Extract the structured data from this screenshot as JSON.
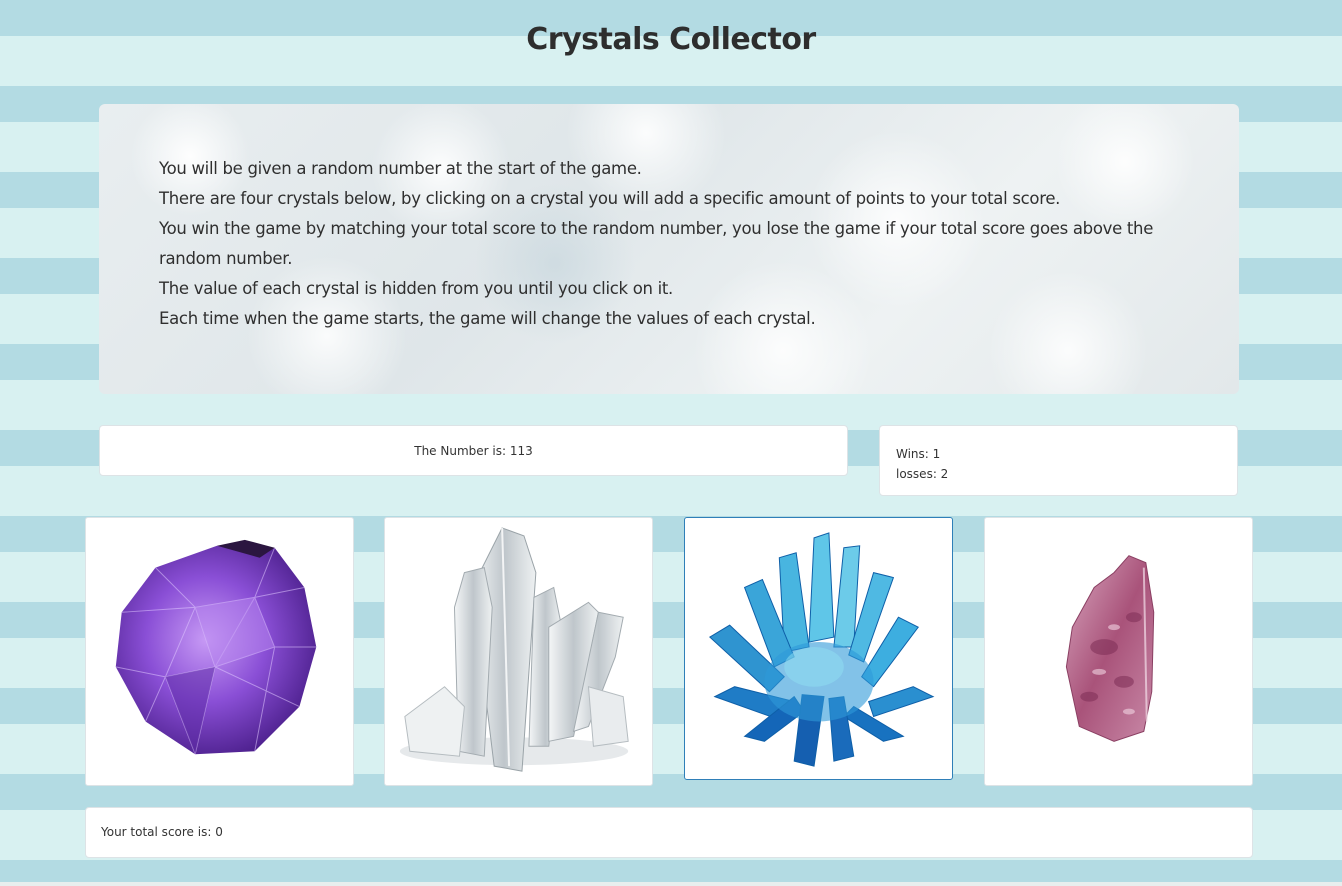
{
  "header": {
    "title": "Crystals Collector"
  },
  "instructions": [
    "You will be given a random number at the start of the game.",
    "There are four crystals below, by clicking on a crystal you will add a specific amount of points to your total score.",
    "You win the game by matching your total score to the random number, you lose the game if your total score goes above the random number.",
    "The value of each crystal is hidden from you until you click on it.",
    "Each time when the game starts, the game will change the values of each crystal."
  ],
  "target": {
    "text": "The Number is: 113",
    "value": 113
  },
  "stats": {
    "wins_text": "Wins: 1",
    "losses_text": "losses: 2",
    "wins": 1,
    "losses": 2
  },
  "score": {
    "text": "Your total score is: 0",
    "value": 0
  },
  "crystals": [
    {
      "icon": "purple-amethyst-crystal-icon",
      "color": "#8a4fd6"
    },
    {
      "icon": "clear-quartz-crystal-icon",
      "color": "#d9dde0"
    },
    {
      "icon": "blue-crystal-cluster-icon",
      "color": "#2aa7d8"
    },
    {
      "icon": "pink-tourmaline-crystal-icon",
      "color": "#b0577f"
    }
  ]
}
